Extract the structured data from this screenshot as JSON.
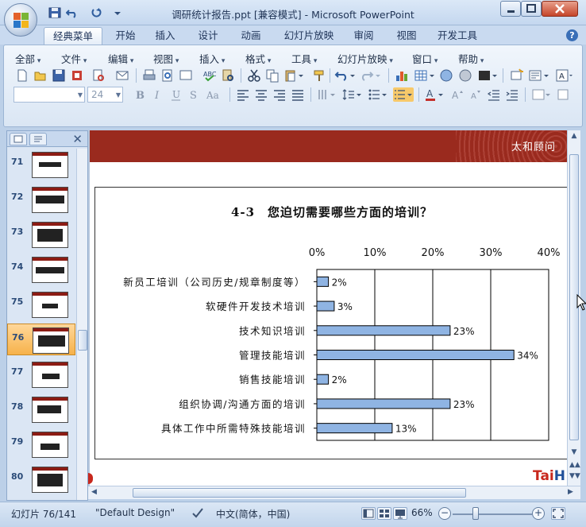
{
  "window": {
    "title": "调研统计报告.ppt [兼容模式] - Microsoft PowerPoint"
  },
  "ribbon_tabs": [
    "经典菜单",
    "开始",
    "插入",
    "设计",
    "动画",
    "幻灯片放映",
    "审阅",
    "视图",
    "开发工具"
  ],
  "classic_menus": [
    "全部",
    "文件",
    "编辑",
    "视图",
    "插入",
    "格式",
    "工具",
    "幻灯片放映",
    "窗口",
    "帮助"
  ],
  "font_size_value": "24",
  "font_name_value": "",
  "thumbnails": [
    {
      "num": "71"
    },
    {
      "num": "72"
    },
    {
      "num": "73"
    },
    {
      "num": "74"
    },
    {
      "num": "75"
    },
    {
      "num": "76",
      "selected": true
    },
    {
      "num": "77"
    },
    {
      "num": "78"
    },
    {
      "num": "79"
    },
    {
      "num": "80"
    }
  ],
  "slide": {
    "brand_text": "太和顾问",
    "logo_left": "Tai",
    "logo_right": "H"
  },
  "chart_data": {
    "type": "bar",
    "orientation": "horizontal",
    "title": "4-3　您迫切需要哪些方面的培训？",
    "categories": [
      "新员工培训（公司历史/规章制度等）",
      "软硬件开发技术培训",
      "技术知识培训",
      "管理技能培训",
      "销售技能培训",
      "组织协调/沟通方面的培训",
      "具体工作中所需特殊技能培训"
    ],
    "values": [
      2,
      3,
      23,
      34,
      2,
      23,
      13
    ],
    "value_labels": [
      "2%",
      "3%",
      "23%",
      "34%",
      "2%",
      "23%",
      "13%"
    ],
    "x_ticks": [
      "0%",
      "10%",
      "20%",
      "30%",
      "40%"
    ],
    "xlim": [
      0,
      40
    ],
    "xlabel": "",
    "ylabel": "",
    "grid": true,
    "bar_color": "#8fb4e3"
  },
  "status": {
    "slide_info": "幻灯片 76/141",
    "theme": "\"Default Design\"",
    "language": "中文(简体，中国)",
    "zoom": "66%"
  },
  "colors": {
    "header_red": "#9a2a1e",
    "accent_blue": "#3a6fb7"
  }
}
